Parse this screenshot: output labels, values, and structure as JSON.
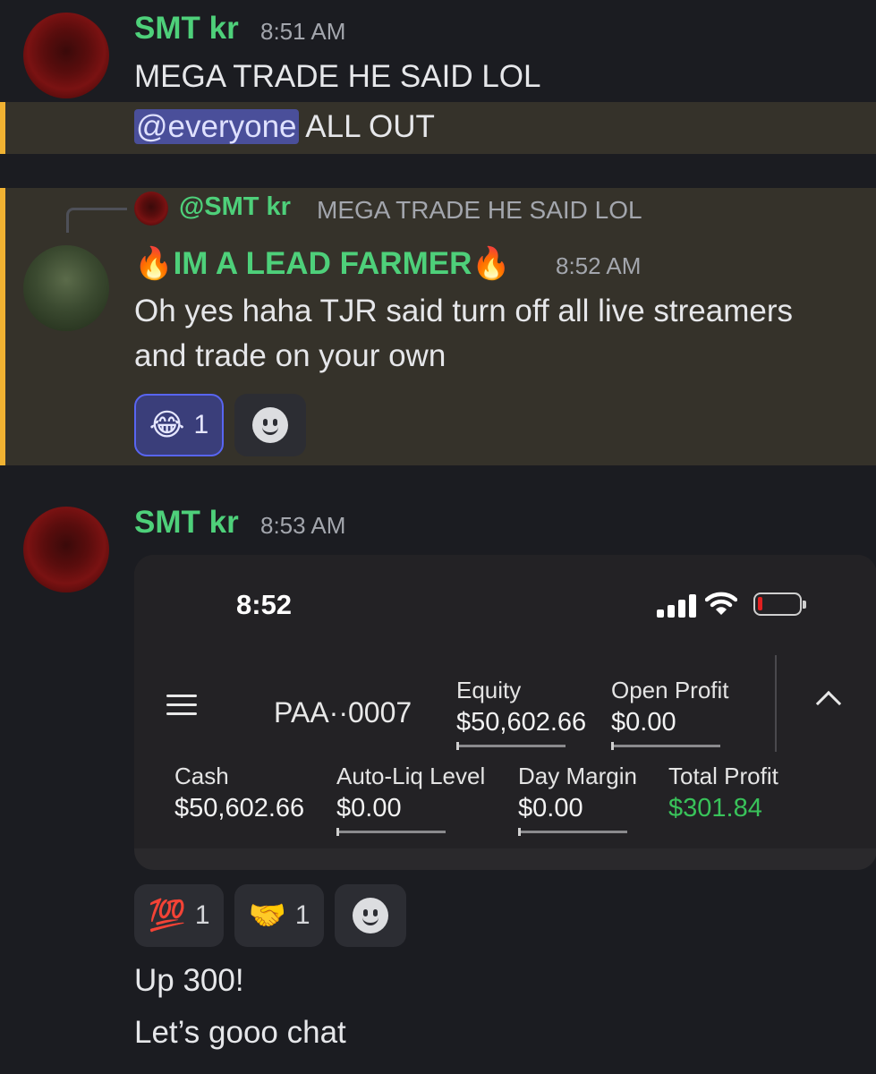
{
  "messages": {
    "m1": {
      "username": "SMT kr",
      "time": "8:51 AM",
      "line1": "MEGA TRADE HE SAID LOL",
      "mention": "@everyone",
      "line2_rest": " ALL OUT"
    },
    "m2": {
      "reply_to_user": "@SMT kr",
      "reply_preview": "MEGA TRADE HE SAID LOL",
      "username": "🔥IM A LEAD FARMER🔥",
      "time": "8:52 AM",
      "line1": "Oh yes haha TJR said turn off all live streamers",
      "line2": "and trade on your own",
      "reactions": [
        {
          "emoji": "😂",
          "count": "1"
        }
      ]
    },
    "m3": {
      "username": "SMT kr",
      "time": "8:53 AM",
      "reactions": [
        {
          "emoji": "💯",
          "count": "1"
        },
        {
          "emoji": "🤝",
          "count": "1"
        }
      ],
      "line1": "Up 300!",
      "line2": "Let’s gooo chat"
    }
  },
  "embed": {
    "clock": "8:52",
    "account": "PAA··0007",
    "metrics": {
      "equity": {
        "label": "Equity",
        "value": "$50,602.66"
      },
      "open_profit": {
        "label": "Open Profit",
        "value": "$0.00"
      },
      "cash": {
        "label": "Cash",
        "value": "$50,602.66"
      },
      "auto_liq": {
        "label": "Auto-Liq Level",
        "value": "$0.00"
      },
      "day_margin": {
        "label": "Day Margin",
        "value": "$0.00"
      },
      "total_profit": {
        "label": "Total Profit",
        "value": "$301.84"
      }
    },
    "battery_level": 0.1
  },
  "colors": {
    "username_green": "#4ed07a",
    "mention_highlight": "#35322a",
    "mention_bar": "#f0b232",
    "profit_green": "#39c25a"
  },
  "icons": {
    "signal": "cellular-signal-icon",
    "wifi": "wifi-icon",
    "battery": "battery-low-icon",
    "menu": "hamburger-menu-icon",
    "collapse": "chevron-up-icon",
    "add_reaction": "add-reaction-smiley-icon"
  }
}
